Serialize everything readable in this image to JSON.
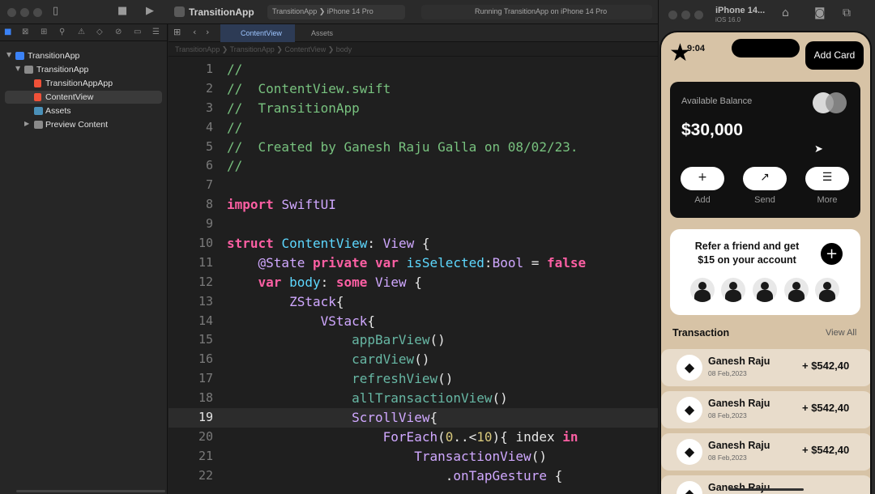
{
  "toolbar": {
    "app_title": "TransitionApp",
    "scheme_project": "TransitionApp",
    "scheme_device": "iPhone 14 Pro",
    "status": "Running TransitionApp on iPhone 14 Pro",
    "icons": [
      "sidebar-icon",
      "stop-icon",
      "play-icon"
    ]
  },
  "navigator": {
    "tree": [
      {
        "label": "TransitionApp",
        "level": 0,
        "kind": "project"
      },
      {
        "label": "TransitionApp",
        "level": 1,
        "kind": "folder"
      },
      {
        "label": "TransitionAppApp",
        "level": 2,
        "kind": "swift"
      },
      {
        "label": "ContentView",
        "level": 2,
        "kind": "swift",
        "selected": true
      },
      {
        "label": "Assets",
        "level": 2,
        "kind": "assets"
      },
      {
        "label": "Preview Content",
        "level": 2,
        "kind": "folder"
      }
    ]
  },
  "editor": {
    "tabs": [
      "ContentView",
      "Assets"
    ],
    "breadcrumb": [
      "TransitionApp",
      "TransitionApp",
      "ContentView",
      "body"
    ],
    "current_line": 19,
    "lines": [
      {
        "n": "1",
        "t": "//"
      },
      {
        "n": "2",
        "t": "//  ContentView.swift"
      },
      {
        "n": "3",
        "t": "//  TransitionApp"
      },
      {
        "n": "4",
        "t": "//"
      },
      {
        "n": "5",
        "t": "//  Created by Ganesh Raju Galla on 08/02/23."
      },
      {
        "n": "6",
        "t": "//"
      },
      {
        "n": "7",
        "t": ""
      },
      {
        "n": "8",
        "t": "import SwiftUI"
      },
      {
        "n": "9",
        "t": ""
      },
      {
        "n": "10",
        "t": "struct ContentView: View {"
      },
      {
        "n": "11",
        "t": "    @State private var isSelected:Bool = false"
      },
      {
        "n": "12",
        "t": "    var body: some View {"
      },
      {
        "n": "13",
        "t": "        ZStack{"
      },
      {
        "n": "14",
        "t": "            VStack{"
      },
      {
        "n": "15",
        "t": "                appBarView()"
      },
      {
        "n": "16",
        "t": "                cardView()"
      },
      {
        "n": "17",
        "t": "                refreshView()"
      },
      {
        "n": "18",
        "t": "                allTransactionView()"
      },
      {
        "n": "19",
        "t": "                ScrollView{"
      },
      {
        "n": "20",
        "t": "                    ForEach(0..<10){ index in"
      },
      {
        "n": "21",
        "t": "                        TransactionView()"
      },
      {
        "n": "22",
        "t": "                            .onTapGesture {"
      }
    ]
  },
  "simulator": {
    "device": "iPhone 14...",
    "os": "iOS 16.0",
    "icons": [
      "home-icon",
      "screenshot-icon",
      "rotate-icon"
    ]
  },
  "app": {
    "time": "9:04",
    "add_card": "Add Card",
    "available_label": "Available Balance",
    "balance": "$30,000",
    "actions": [
      {
        "label": "Add",
        "glyph": "+"
      },
      {
        "label": "Send",
        "glyph": "↗"
      },
      {
        "label": "More",
        "glyph": "☰"
      }
    ],
    "refer_text": "Refer a friend and get $15 on your account",
    "transaction_title": "Transaction",
    "view_all": "View All",
    "transactions": [
      {
        "name": "Ganesh Raju",
        "date": "08 Feb,2023",
        "amount": "+ $542,40"
      },
      {
        "name": "Ganesh Raju",
        "date": "08 Feb,2023",
        "amount": "+ $542,40"
      },
      {
        "name": "Ganesh Raju",
        "date": "08 Feb,2023",
        "amount": "+ $542,40"
      },
      {
        "name": "Ganesh Raju",
        "date": "",
        "amount": ""
      }
    ],
    "colors": {
      "background": "#d7c3a6",
      "card": "#111111",
      "row": "#e8dccb"
    }
  }
}
